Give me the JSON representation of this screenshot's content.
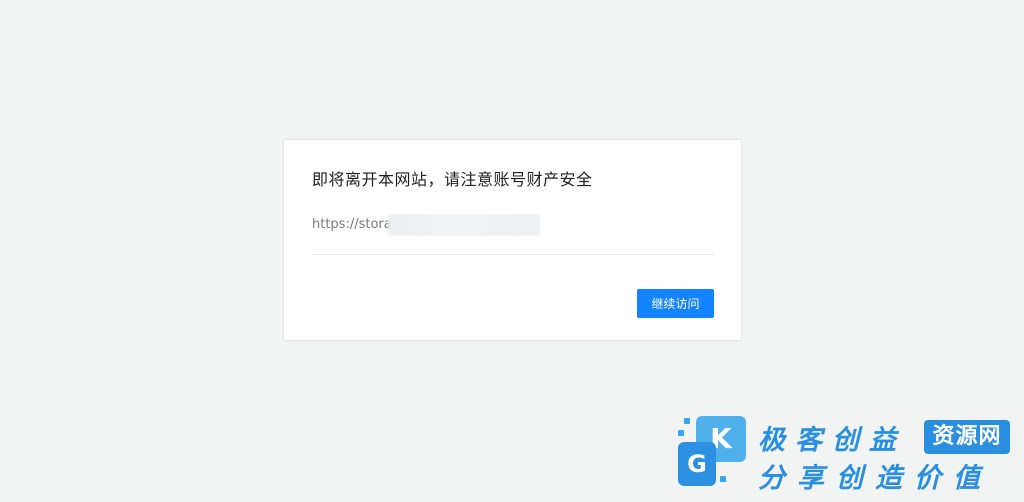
{
  "dialog": {
    "title": "即将离开本网站，请注意账号财产安全",
    "url_visible": "https://stora",
    "continue_label": "继续访问"
  },
  "watermark": {
    "logo_letters": [
      "K",
      "G"
    ],
    "line1": "极客创益",
    "badge": "资源网",
    "line2": "分享创造价值"
  },
  "colors": {
    "background": "#f2f3f3",
    "card": "#ffffff",
    "primary_button": "#1483ff",
    "watermark_blue": "#2a8fe0"
  }
}
